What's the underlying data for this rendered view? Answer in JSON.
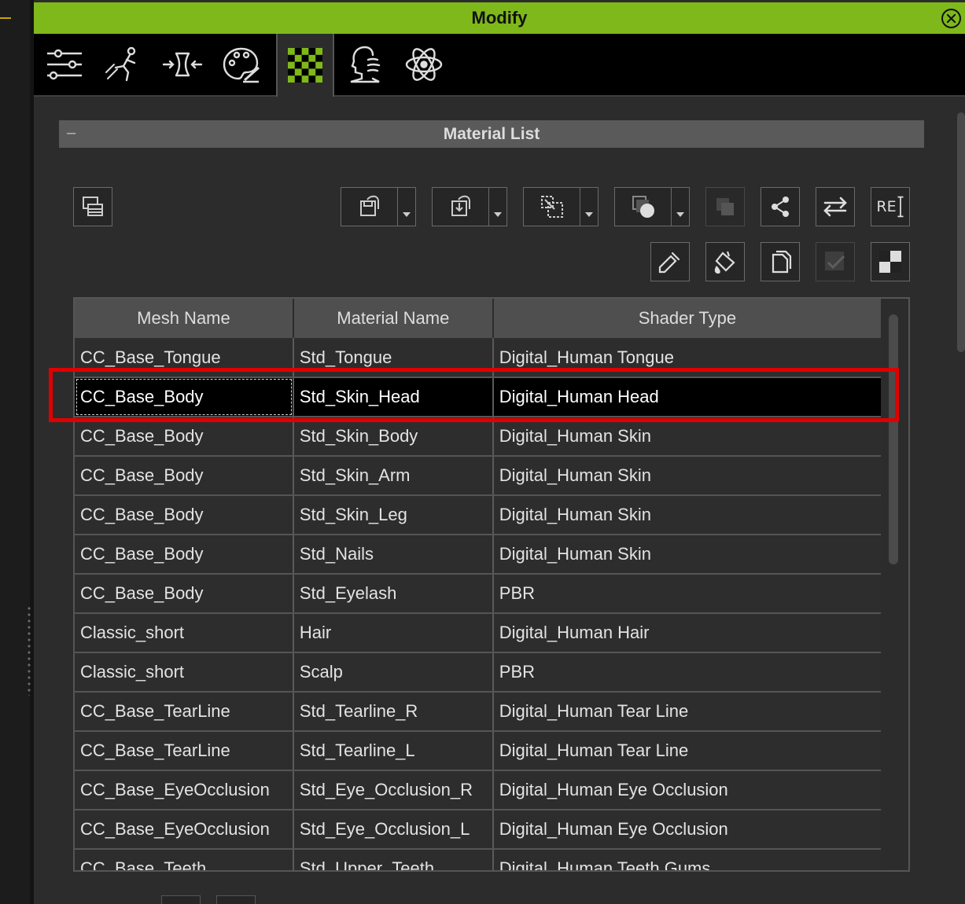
{
  "panel": {
    "title": "Modify",
    "tabs": [
      {
        "icon": "sliders-icon"
      },
      {
        "icon": "motion-icon"
      },
      {
        "icon": "morph-icon"
      },
      {
        "icon": "palette-icon"
      },
      {
        "icon": "checker-material-icon",
        "active": true
      },
      {
        "icon": "head-wave-icon"
      },
      {
        "icon": "atom-physics-icon"
      }
    ]
  },
  "section": {
    "collapse_symbol": "–",
    "title": "Material List"
  },
  "toolbar": {
    "re_label": "RE"
  },
  "table": {
    "columns": [
      "Mesh Name",
      "Material Name",
      "Shader Type"
    ],
    "rows": [
      [
        "CC_Base_Tongue",
        "Std_Tongue",
        "Digital_Human Tongue"
      ],
      [
        "CC_Base_Body",
        "Std_Skin_Head",
        "Digital_Human Head"
      ],
      [
        "CC_Base_Body",
        "Std_Skin_Body",
        "Digital_Human Skin"
      ],
      [
        "CC_Base_Body",
        "Std_Skin_Arm",
        "Digital_Human Skin"
      ],
      [
        "CC_Base_Body",
        "Std_Skin_Leg",
        "Digital_Human Skin"
      ],
      [
        "CC_Base_Body",
        "Std_Nails",
        "Digital_Human Skin"
      ],
      [
        "CC_Base_Body",
        "Std_Eyelash",
        "PBR"
      ],
      [
        "Classic_short",
        "Hair",
        "Digital_Human Hair"
      ],
      [
        "Classic_short",
        "Scalp",
        "PBR"
      ],
      [
        "CC_Base_TearLine",
        "Std_Tearline_R",
        "Digital_Human Tear Line"
      ],
      [
        "CC_Base_TearLine",
        "Std_Tearline_L",
        "Digital_Human Tear Line"
      ],
      [
        "CC_Base_EyeOcclusion",
        "Std_Eye_Occlusion_R",
        "Digital_Human Eye Occlusion"
      ],
      [
        "CC_Base_EyeOcclusion",
        "Std_Eye_Occlusion_L",
        "Digital_Human Eye Occlusion"
      ],
      [
        "CC_Base_Teeth",
        "Std_Upper_Teeth",
        "Digital_Human Teeth Gums"
      ]
    ],
    "selected_row": 1
  },
  "colors": {
    "title_bar": "#7fb81a",
    "highlight": "#e00000",
    "selected_row": "#000000"
  }
}
